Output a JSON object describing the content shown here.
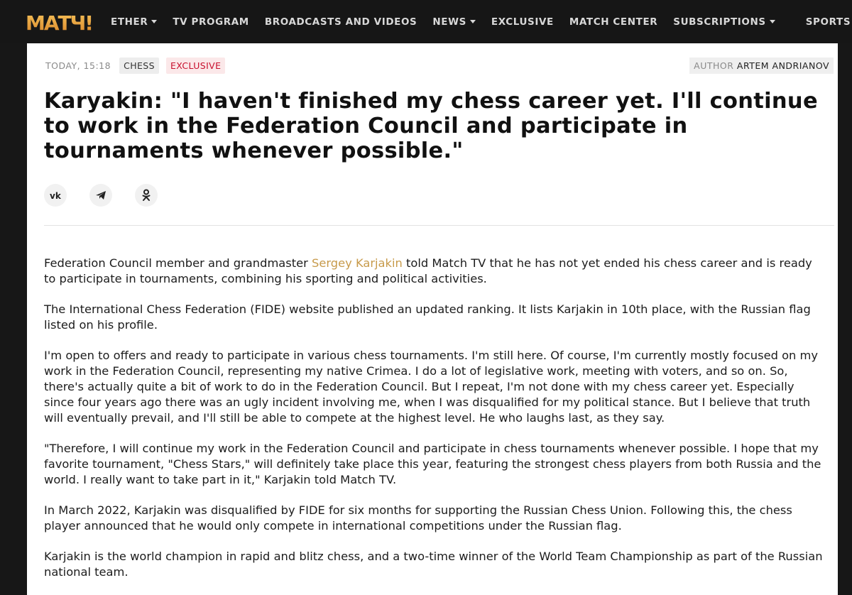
{
  "nav": {
    "logo_text": "МАТЧ!",
    "items": [
      {
        "label": "ETHER",
        "dropdown": true
      },
      {
        "label": "TV PROGRAM",
        "dropdown": false
      },
      {
        "label": "BROADCASTS AND VIDEOS",
        "dropdown": false
      },
      {
        "label": "NEWS",
        "dropdown": true
      },
      {
        "label": "EXCLUSIVE",
        "dropdown": false
      },
      {
        "label": "MATCH CENTER",
        "dropdown": false
      },
      {
        "label": "SUBSCRIPTIONS",
        "dropdown": true
      }
    ],
    "sports": {
      "label": "SPORTS",
      "dropdown": true
    }
  },
  "article": {
    "time": "TODAY, 15:18",
    "tags": [
      "CHESS",
      "EXCLUSIVE"
    ],
    "author_label": "AUTHOR",
    "author_name": "ARTEM ANDRIANOV",
    "headline": "Karyakin: \"I haven't finished my chess career yet. I'll continue to work in the Federation Council and participate in tournaments whenever possible.\"",
    "share_icons": [
      "vk-icon",
      "telegram-icon",
      "odnoklassniki-icon"
    ],
    "p1_before": "Federation Council member and grandmaster ",
    "p1_link": "Sergey Karjakin",
    "p1_after": " told Match TV that he has not yet ended his chess career and is ready to participate in tournaments, combining his sporting and political activities.",
    "paragraphs": [
      "The International Chess Federation (FIDE) website published an updated ranking. It lists Karjakin in 10th place, with the Russian flag listed on his profile.",
      "I'm open to offers and ready to participate in various chess tournaments. I'm still here. Of course, I'm currently mostly focused on my work in the Federation Council, representing my native Crimea. I do a lot of legislative work, meeting with voters, and so on. So, there's actually quite a bit of work to do in the Federation Council. But I repeat, I'm not done with my chess career yet. Especially since four years ago there was an ugly incident involving me, when I was disqualified for my political stance. But I believe that truth will eventually prevail, and I'll still be able to compete at the highest level. He who laughs last, as they say.",
      "\"Therefore, I will continue my work in the Federation Council and participate in chess tournaments whenever possible. I hope that my favorite tournament, \"Chess Stars,\" will definitely take place this year, featuring the strongest chess players from both Russia and the world. I really want to take part in it,\" Karjakin told Match TV.",
      "In March 2022, Karjakin was disqualified by FIDE for six months for supporting the Russian Chess Union. Following this, the chess player announced that he would only compete in international competitions under the Russian flag.",
      "Karjakin is the world champion in rapid and blitz chess, and a two-time winner of the World Team Championship as part of the Russian national team."
    ]
  },
  "colors": {
    "nav_bg": "#161616",
    "link": "#c79a4a",
    "exclusive": "#c8102e",
    "logo": "#e8a33d"
  }
}
